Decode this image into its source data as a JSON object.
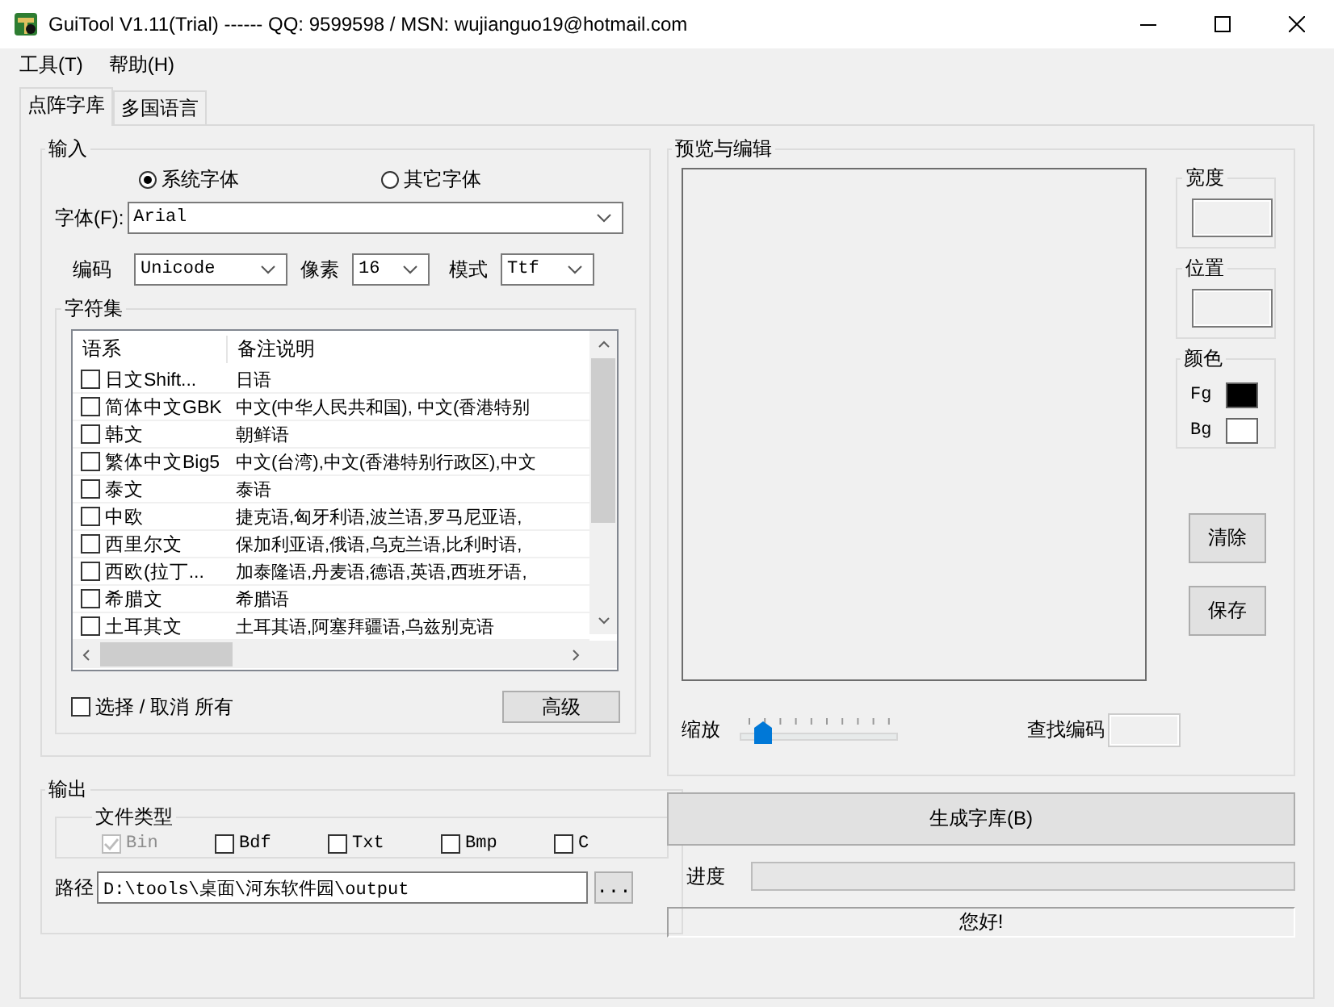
{
  "window": {
    "title": "GuiTool V1.11(Trial) ------ QQ: 9599598 / MSN: wujianguo19@hotmail.com"
  },
  "menu": [
    {
      "label": "工具(T)"
    },
    {
      "label": "帮助(H)"
    }
  ],
  "tabs": [
    {
      "label": "点阵字库",
      "selected": true
    },
    {
      "label": "多国语言",
      "selected": false
    }
  ],
  "input": {
    "title": "输入",
    "font_source": [
      {
        "label": "系统字体",
        "selected": true
      },
      {
        "label": "其它字体",
        "selected": false
      }
    ],
    "font_label": "字体(F):",
    "font_value": "Arial",
    "encoding_label": "编码",
    "encoding_value": "Unicode",
    "pixel_label": "像素",
    "pixel_value": "16",
    "mode_label": "模式",
    "mode_value": "Ttf",
    "charset": {
      "title": "字符集",
      "columns": [
        "语系",
        "备注说明"
      ],
      "rows": [
        {
          "name": "日文Shift...",
          "note": "日语",
          "checked": false
        },
        {
          "name": "简体中文GBK",
          "note": "中文(中华人民共和国), 中文(香港特别",
          "checked": false
        },
        {
          "name": "韩文",
          "note": "朝鲜语",
          "checked": false
        },
        {
          "name": "繁体中文Big5",
          "note": "中文(台湾),中文(香港特别行政区),中文",
          "checked": false
        },
        {
          "name": "泰文",
          "note": "泰语",
          "checked": false
        },
        {
          "name": "中欧",
          "note": "捷克语,匈牙利语,波兰语,罗马尼亚语,",
          "checked": false
        },
        {
          "name": "西里尔文",
          "note": "保加利亚语,俄语,乌克兰语,比利时语,",
          "checked": false
        },
        {
          "name": "西欧(拉丁...",
          "note": "加泰隆语,丹麦语,德语,英语,西班牙语,",
          "checked": false
        },
        {
          "name": "希腊文",
          "note": "希腊语",
          "checked": false
        },
        {
          "name": "土耳其文",
          "note": "土耳其语,阿塞拜疆语,乌兹别克语",
          "checked": false
        }
      ]
    },
    "select_all": {
      "label": "选择 / 取消 所有",
      "checked": false
    },
    "advanced_button": "高级"
  },
  "output": {
    "title": "输出",
    "file_type_title": "文件类型",
    "file_types": [
      {
        "label": "Bin",
        "checked": true,
        "disabled": true
      },
      {
        "label": "Bdf",
        "checked": false,
        "disabled": false
      },
      {
        "label": "Txt",
        "checked": false,
        "disabled": false
      },
      {
        "label": "Bmp",
        "checked": false,
        "disabled": false
      },
      {
        "label": "C",
        "checked": false,
        "disabled": false
      }
    ],
    "path_label": "路径",
    "path_value": "D:\\tools\\桌面\\河东软件园\\output",
    "browse_button": "..."
  },
  "preview": {
    "title": "预览与编辑",
    "width_title": "宽度",
    "position_title": "位置",
    "color_title": "颜色",
    "colors": [
      {
        "label": "Fg",
        "color": "#000000"
      },
      {
        "label": "Bg",
        "color": "#ffffff"
      }
    ],
    "clear_button": "清除",
    "save_button": "保存",
    "zoom_label": "缩放",
    "zoom": {
      "level": 0.1
    },
    "find_label": "查找编码"
  },
  "generate_button": "生成字库(B)",
  "progress": {
    "label": "进度",
    "level": 0
  },
  "status_bar": "您好!"
}
